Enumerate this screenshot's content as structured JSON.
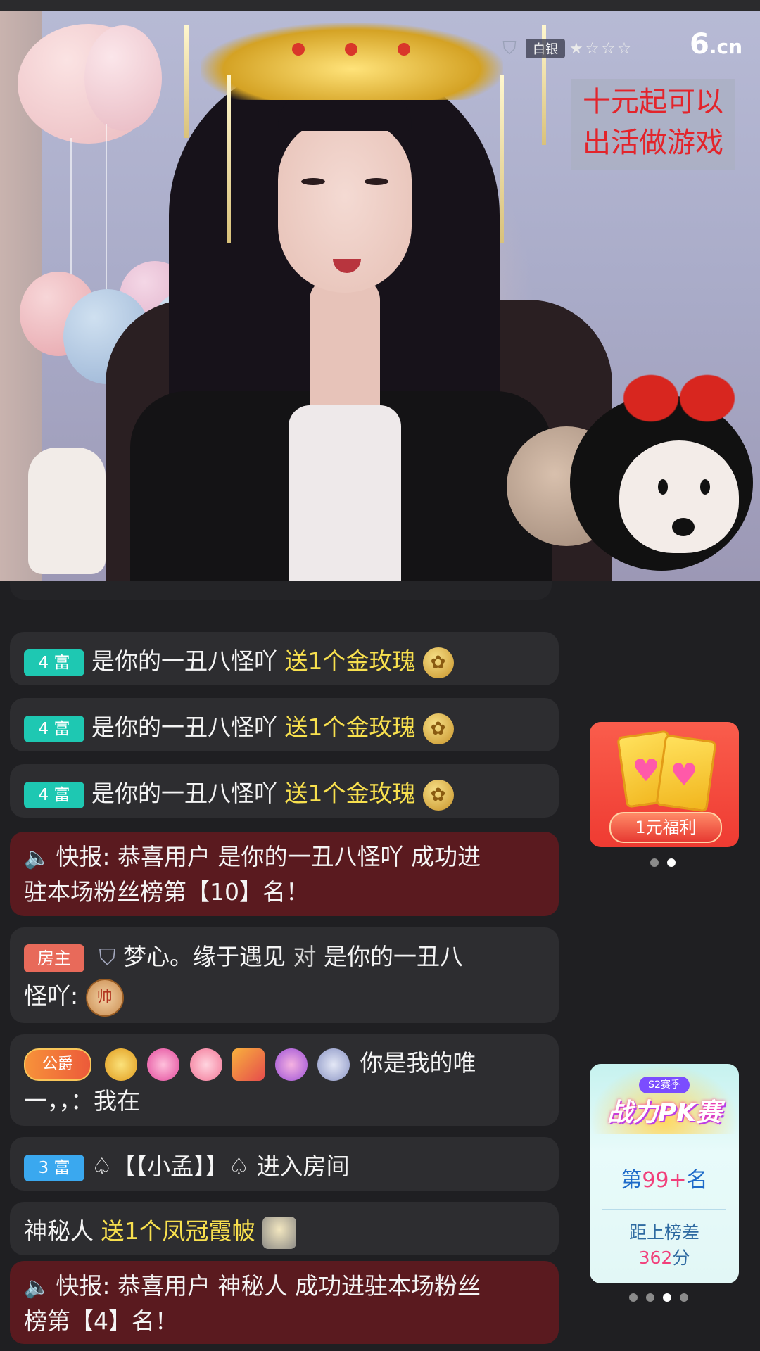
{
  "stream": {
    "level_label": "白银",
    "stars": "★☆☆☆",
    "logo_main": "6",
    "logo_sub": ".cn",
    "promo_line1": "十元起可以",
    "promo_line2": "出活做游戏"
  },
  "chat": {
    "messages": [
      {
        "badge": "4 富",
        "user": "是你的一丑八怪吖",
        "action": "送1个金玫瑰",
        "gift_icon": "rose-icon"
      },
      {
        "badge": "4 富",
        "user": "是你的一丑八怪吖",
        "action": "送1个金玫瑰",
        "gift_icon": "rose-icon"
      },
      {
        "badge": "4 富",
        "user": "是你的一丑八怪吖",
        "action": "送1个金玫瑰",
        "gift_icon": "rose-icon"
      },
      {
        "type": "notice",
        "line1": "快报: 恭喜用户 是你的一丑八怪吖 成功进",
        "line2": "驻本场粉丝榜第【10】名！"
      },
      {
        "badge": "房主",
        "user": "梦心。缘于遇见",
        "to": "对",
        "target_line1": "是你的一丑八",
        "target_line2": "怪吖:",
        "sticker": "帅"
      },
      {
        "badge": "公爵",
        "text_line1": "你是我的唯",
        "text_line2": "一，，：我在"
      },
      {
        "badge": "3 富",
        "text": "♤【【小孟】】♤ 进入房间"
      },
      {
        "user": "神秘人",
        "action": "送1个凤冠霞帔",
        "gift_icon": "crown-icon"
      },
      {
        "type": "notice",
        "line1": "快报: 恭喜用户 神秘人 成功进驻本场粉丝",
        "line2": "榜第【4】名！"
      }
    ]
  },
  "welfare": {
    "button_label": "1元福利",
    "pages": 2,
    "active_page": 2
  },
  "pk": {
    "season": "S2赛季",
    "title": "战力PK赛",
    "rank_prefix": "第",
    "rank_value": "99+",
    "rank_suffix": "名",
    "gap_label": "距上榜差",
    "gap_value": "362",
    "gap_unit": "分",
    "pages": 4,
    "active_page": 3
  },
  "colors": {
    "gift_text": "#f8e04e",
    "notice_bg": "#5a1a1f",
    "fu4_badge": "#1ec8b2",
    "fu3_badge": "#3aa8ef",
    "host_badge": "#e86a5a"
  }
}
